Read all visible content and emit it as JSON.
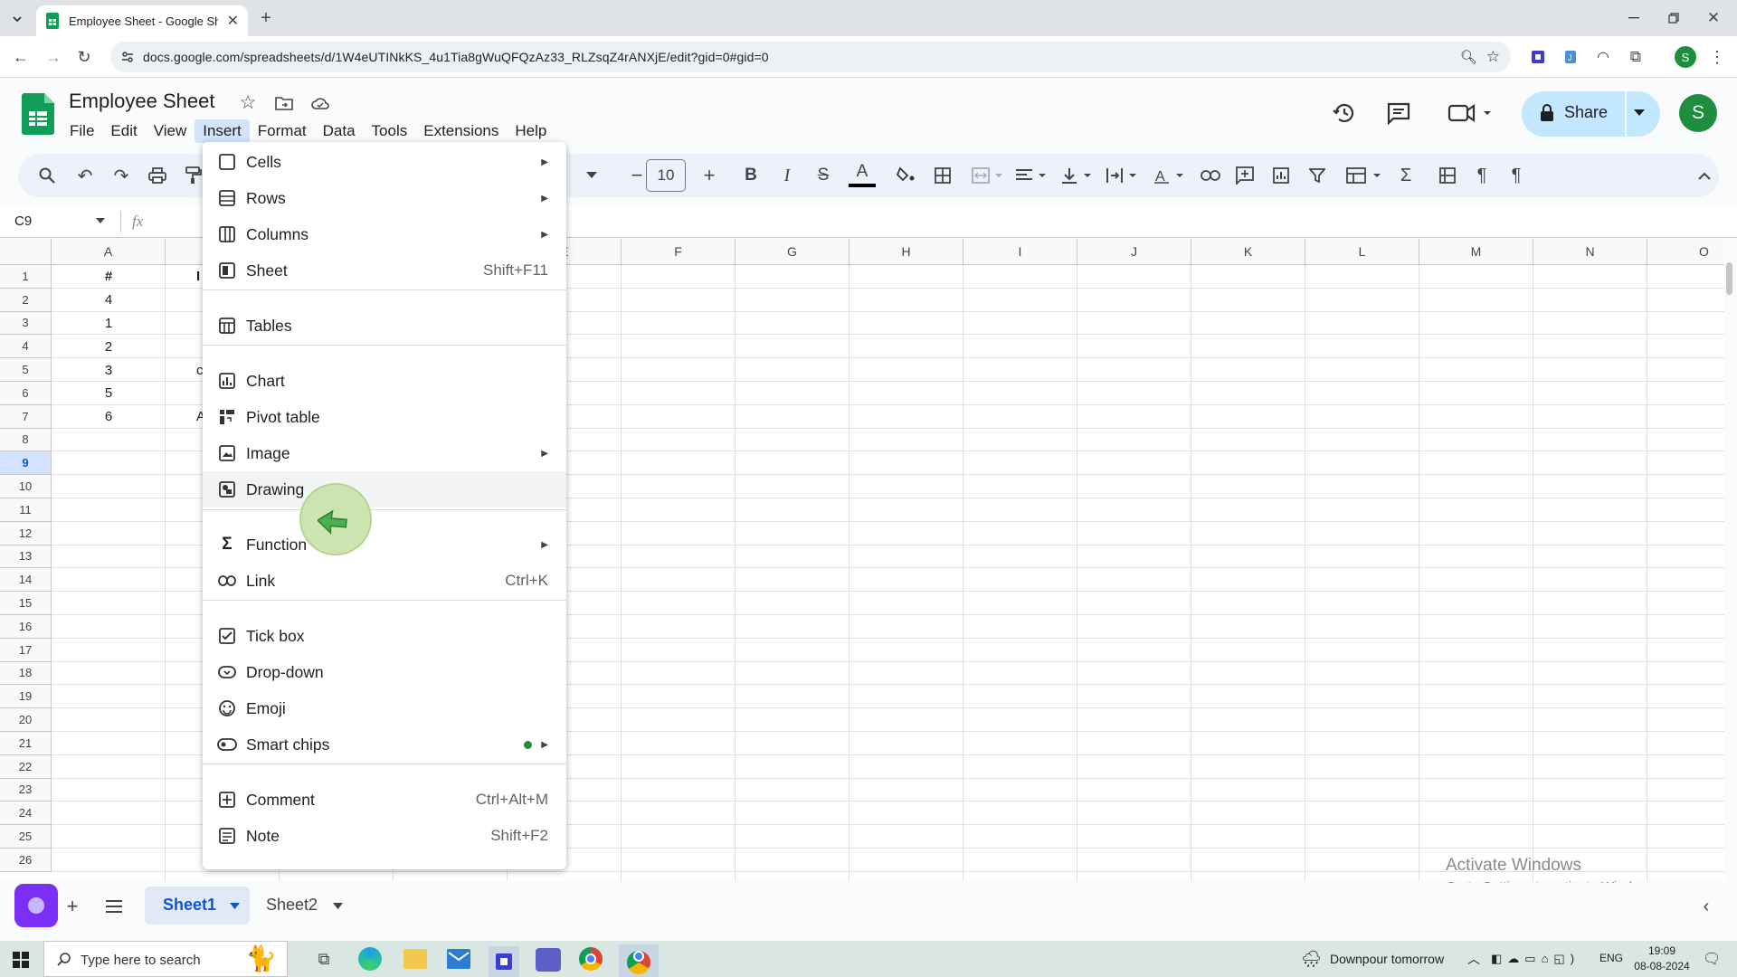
{
  "browser": {
    "tab_title": "Employee Sheet - Google Sheets",
    "url": "docs.google.com/spreadsheets/d/1W4eUTINkKS_4u1Tia8gWuQFQzAz33_RLZsqZ4rANXjE/edit?gid=0#gid=0",
    "profile_initial": "S"
  },
  "app": {
    "doc_title": "Employee Sheet",
    "menus": [
      "File",
      "Edit",
      "View",
      "Insert",
      "Format",
      "Data",
      "Tools",
      "Extensions",
      "Help"
    ],
    "share_label": "Share",
    "account_initial": "S"
  },
  "toolbar": {
    "font_size": "10"
  },
  "formula_bar": {
    "cell_ref": "C9",
    "fx": "fx"
  },
  "grid": {
    "columns": [
      "A",
      "",
      "",
      "",
      "E",
      "F",
      "G",
      "H",
      "I",
      "J",
      "K",
      "L",
      "M",
      "N",
      "O"
    ],
    "rows": [
      "1",
      "2",
      "3",
      "4",
      "5",
      "6",
      "7",
      "8",
      "9",
      "10",
      "11",
      "12",
      "13",
      "14",
      "15",
      "16",
      "17",
      "18",
      "19",
      "20",
      "21",
      "22",
      "23",
      "24",
      "25",
      "26"
    ],
    "selected_row": "9",
    "col_a_values": [
      "#",
      "4",
      "1",
      "2",
      "3",
      "5",
      "6"
    ],
    "col_b_partial": [
      "I",
      "",
      "",
      "",
      "c",
      "",
      "A"
    ]
  },
  "insert_menu": {
    "items": [
      {
        "label": "Cells",
        "icon": "cells-icon",
        "shortcut": "",
        "submenu": true
      },
      {
        "label": "Rows",
        "icon": "rows-icon",
        "shortcut": "",
        "submenu": true
      },
      {
        "label": "Columns",
        "icon": "columns-icon",
        "shortcut": "",
        "submenu": true
      },
      {
        "label": "Sheet",
        "icon": "sheet-icon",
        "shortcut": "Shift+F11",
        "submenu": false
      },
      {
        "label": "Tables",
        "icon": "tables-icon",
        "shortcut": "",
        "submenu": false
      },
      {
        "label": "Chart",
        "icon": "chart-icon",
        "shortcut": "",
        "submenu": false
      },
      {
        "label": "Pivot table",
        "icon": "pivot-table-icon",
        "shortcut": "",
        "submenu": false
      },
      {
        "label": "Image",
        "icon": "image-icon",
        "shortcut": "",
        "submenu": true
      },
      {
        "label": "Drawing",
        "icon": "drawing-icon",
        "shortcut": "",
        "submenu": false
      },
      {
        "label": "Function",
        "icon": "function-icon",
        "shortcut": "",
        "submenu": true
      },
      {
        "label": "Link",
        "icon": "link-icon",
        "shortcut": "Ctrl+K",
        "submenu": false
      },
      {
        "label": "Tick box",
        "icon": "tick-box-icon",
        "shortcut": "",
        "submenu": false
      },
      {
        "label": "Drop-down",
        "icon": "dropdown-icon",
        "shortcut": "",
        "submenu": false
      },
      {
        "label": "Emoji",
        "icon": "emoji-icon",
        "shortcut": "",
        "submenu": false
      },
      {
        "label": "Smart chips",
        "icon": "smart-chips-icon",
        "shortcut": "",
        "submenu": true
      },
      {
        "label": "Comment",
        "icon": "comment-icon",
        "shortcut": "Ctrl+Alt+M",
        "submenu": false
      },
      {
        "label": "Note",
        "icon": "note-icon",
        "shortcut": "Shift+F2",
        "submenu": false
      }
    ]
  },
  "sheets": {
    "tabs": [
      "Sheet1",
      "Sheet2"
    ],
    "active": "Sheet1"
  },
  "watermark": {
    "line1": "Activate Windows",
    "line2": "Go to Settings to activate Windows."
  },
  "taskbar": {
    "search_placeholder": "Type here to search",
    "weather": "Downpour tomorrow",
    "lang": "ENG",
    "time": "19:09",
    "date": "08-08-2024"
  },
  "colors": {
    "accent": "#0b57d0",
    "share_bg": "#c2e7ff",
    "sheets_green": "#0f9d58",
    "cursor_highlight": "#c5e1a5"
  }
}
